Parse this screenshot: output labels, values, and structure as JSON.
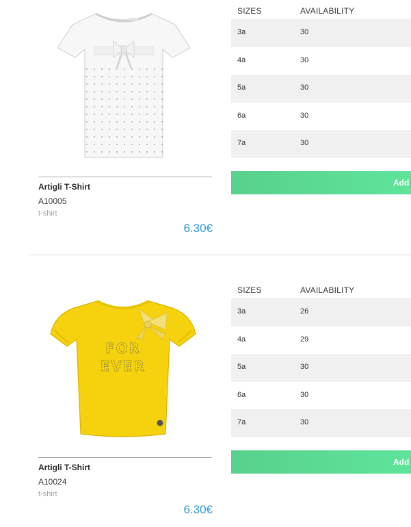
{
  "table_headers": {
    "size": "SIZES",
    "availability": "AVAILABILITY"
  },
  "add_button_label": "Add",
  "colors": {
    "price": "#2f97d4",
    "add_button": "#5ad892",
    "row_shade": "#f0f0f0"
  },
  "products": [
    {
      "name": "Artigli T-Shirt",
      "code": "A10005",
      "category": "t-shirt",
      "price": "6.30€",
      "image": "white-tshirt-image",
      "sizes": [
        {
          "size": "3a",
          "availability": "30"
        },
        {
          "size": "4a",
          "availability": "30"
        },
        {
          "size": "5a",
          "availability": "30"
        },
        {
          "size": "6a",
          "availability": "30"
        },
        {
          "size": "7a",
          "availability": "30"
        }
      ]
    },
    {
      "name": "Artigli T-Shirt",
      "code": "A10024",
      "category": "t-shirt",
      "price": "6.30€",
      "image": "yellow-forever-tshirt-image",
      "print_text": "FOR EVER",
      "sizes": [
        {
          "size": "3a",
          "availability": "26"
        },
        {
          "size": "4a",
          "availability": "29"
        },
        {
          "size": "5a",
          "availability": "30"
        },
        {
          "size": "6a",
          "availability": "30"
        },
        {
          "size": "7a",
          "availability": "30"
        }
      ]
    }
  ]
}
